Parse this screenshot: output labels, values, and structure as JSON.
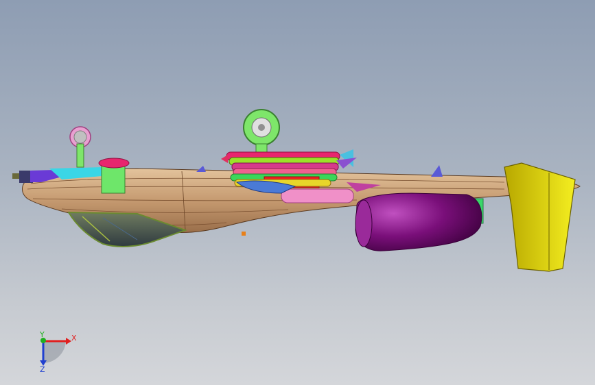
{
  "viewport": {
    "background_top": "#8e9db3",
    "background_bottom": "#d4d6da"
  },
  "model": {
    "fuselage_color": "#c9a27a",
    "engine_color": "#7a0f7a",
    "tail_color": "#e8e000",
    "canopy_color": "#7d8c6a",
    "missile_colors": [
      "#e8266e",
      "#9be22a",
      "#d63a8a",
      "#f06090",
      "#3bd65a",
      "#e8d62a"
    ],
    "wheel_color": "#7ee66a",
    "nose_gear_color": "#e8a0d0"
  },
  "triad": {
    "x_label": "X",
    "y_label": "Y",
    "z_label": "Z",
    "x_color": "#e02020",
    "y_color": "#20b020",
    "z_color": "#2040d0"
  }
}
